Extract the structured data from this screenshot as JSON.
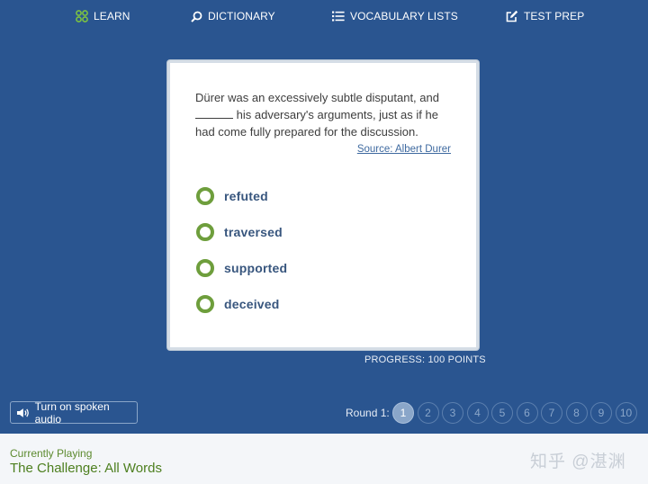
{
  "nav": {
    "learn": "LEARN",
    "dictionary": "DICTIONARY",
    "vocabulary_lists": "VOCABULARY LISTS",
    "test_prep": "TEST PREP"
  },
  "question": {
    "part1": "Dürer was an excessively subtle disputant, and",
    "part2": "his adversary's arguments, just as if he had come fully prepared for the discussion.",
    "source": "Source: Albert Durer"
  },
  "choices": [
    "refuted",
    "traversed",
    "supported",
    "deceived"
  ],
  "progress": "PROGRESS: 100 POINTS",
  "audio_button": "Turn on spoken audio",
  "round": {
    "label": "Round 1:",
    "numbers": [
      "1",
      "2",
      "3",
      "4",
      "5",
      "6",
      "7",
      "8",
      "9",
      "10"
    ],
    "active": "1"
  },
  "footer": {
    "currently_playing_label": "Currently Playing",
    "currently_playing_title": "The Challenge: All Words",
    "watermark": "知乎 @湛渊"
  },
  "colors": {
    "background": "#2a5590",
    "radio": "#6e9e3c",
    "choice_text": "#38567e",
    "footer_green": "#4d7f1f"
  }
}
